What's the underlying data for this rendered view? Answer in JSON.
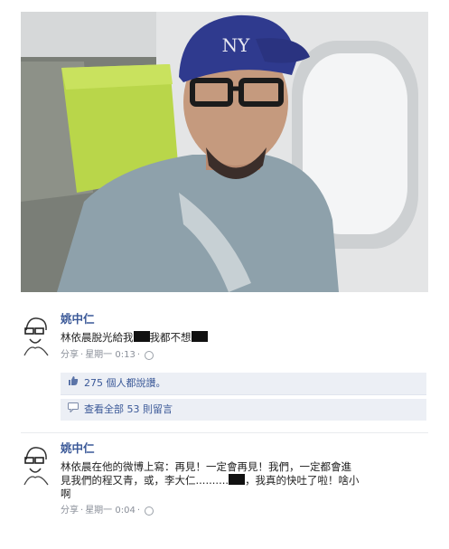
{
  "post1": {
    "author": "姚中仁",
    "text_before": "林依晨脫光給我",
    "text_middle": "我都不想",
    "share": "分享",
    "time": "星期一 0:13",
    "likes": "275 個人都說讚。",
    "view_comments": "查看全部 53 則留言"
  },
  "post2": {
    "author": "姚中仁",
    "text_part1": "林依晨在他的微博上寫：再見！一定會再見！我們，一定都會進",
    "text_part2": "見我們的程又青，或，李大仁..........",
    "text_part3": "，我真的快吐了啦！啥小",
    "text_part4": "啊",
    "share": "分享",
    "time": "星期一 0:04"
  },
  "icons": {
    "like": "thumbs-up-icon",
    "comment": "comment-bubble-icon",
    "globe": "globe-icon",
    "avatar": "sketch-avatar-icon"
  },
  "colors": {
    "link": "#3b5998",
    "panel": "#eceff5",
    "meta": "#8a8f99"
  }
}
